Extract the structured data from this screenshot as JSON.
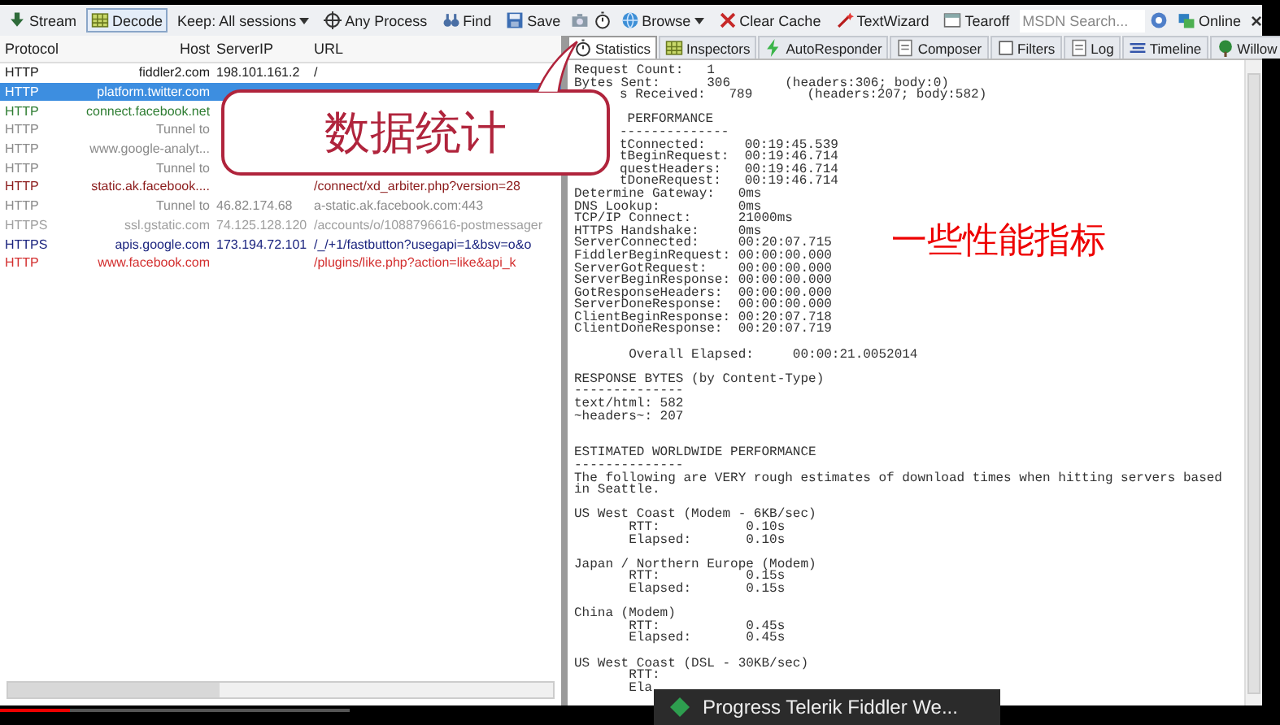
{
  "toolbar": [
    {
      "kind": "button",
      "label": "Stream"
    },
    {
      "kind": "toggle",
      "label": "Decode",
      "on": true
    },
    {
      "kind": "dropdown",
      "label": "Keep: All sessions"
    },
    {
      "kind": "button",
      "label": "Any Process"
    },
    {
      "kind": "button",
      "label": "Find"
    },
    {
      "kind": "button",
      "label": "Save"
    },
    {
      "kind": "icon"
    },
    {
      "kind": "icon"
    },
    {
      "kind": "dropdown",
      "label": "Browse"
    },
    {
      "kind": "button",
      "label": "Clear Cache"
    },
    {
      "kind": "button",
      "label": "TextWizard"
    },
    {
      "kind": "button",
      "label": "Tearoff"
    },
    {
      "kind": "search",
      "placeholder": "MSDN Search..."
    },
    {
      "kind": "icon"
    },
    {
      "kind": "button",
      "label": "Online"
    },
    {
      "kind": "close",
      "label": "×"
    }
  ],
  "sessions": {
    "columns": [
      "Protocol",
      "Host",
      "ServerIP",
      "URL"
    ],
    "rows": [
      {
        "protocol": "HTTP",
        "host": "fiddler2.com",
        "server_ip": "198.101.161.2",
        "url": "/",
        "color": "#202020",
        "selected": false
      },
      {
        "protocol": "HTTP",
        "host": "platform.twitter.com",
        "selected": true
      },
      {
        "protocol": "HTTP",
        "host": "connect.facebook.net",
        "color": "#2e7d32",
        "selected": false
      },
      {
        "protocol": "HTTP",
        "host": "Tunnel to",
        "color": "#8a8a8a",
        "selected": false
      },
      {
        "protocol": "HTTP",
        "host": "www.google-analyt...",
        "color": "#8a8a8a",
        "selected": false
      },
      {
        "protocol": "HTTP",
        "host": "Tunnel to",
        "color": "#8a8a8a",
        "selected": false
      },
      {
        "protocol": "HTTP",
        "host": "static.ak.facebook....",
        "url": "/connect/xd_arbiter.php?version=28",
        "color": "#8b1a1a",
        "selected": false
      },
      {
        "protocol": "HTTP",
        "host": "Tunnel to",
        "server_ip": "46.82.174.68",
        "url": "a-static.ak.facebook.com:443",
        "color": "#8a8a8a",
        "selected": false
      },
      {
        "protocol": "HTTPS",
        "host": "ssl.gstatic.com",
        "server_ip": "74.125.128.120",
        "url": "/accounts/o/1088796616-postmessager",
        "color": "#a0a0a0",
        "selected": false
      },
      {
        "protocol": "HTTPS",
        "host": "apis.google.com",
        "server_ip": "173.194.72.101",
        "url": "/_/+1/fastbutton?usegapi=1&bsv=o&o",
        "color": "#1a237e",
        "selected": false
      },
      {
        "protocol": "HTTP",
        "host": "www.facebook.com",
        "url": "/plugins/like.php?action=like&api_k",
        "color": "#d32f2f",
        "selected": false
      }
    ]
  },
  "tabs": [
    {
      "label": "Statistics",
      "selected": true
    },
    {
      "label": "Inspectors",
      "selected": false
    },
    {
      "label": "AutoResponder",
      "selected": false
    },
    {
      "label": "Composer",
      "selected": false
    },
    {
      "label": "Filters",
      "selected": false
    },
    {
      "label": "Log",
      "selected": false
    },
    {
      "label": "Timeline",
      "selected": false
    },
    {
      "label": "Willow",
      "selected": false
    }
  ],
  "statistics": [
    {
      "kind": "line",
      "text": "Request Count:   1"
    },
    {
      "kind": "line",
      "text": "Bytes Sent:      306       (headers:306; body:0)"
    },
    {
      "kind": "partial",
      "text": "s Received:   789       (headers:207; body:582)"
    },
    {
      "kind": "blank"
    },
    {
      "kind": "partial",
      "text": " PERFORMANCE"
    },
    {
      "kind": "partial",
      "text": "--------------"
    },
    {
      "kind": "partial",
      "text": "tConnected:     00:19:45.539"
    },
    {
      "kind": "partial",
      "text": "tBeginRequest:  00:19:46.714"
    },
    {
      "kind": "partial",
      "text": "questHeaders:   00:19:46.714"
    },
    {
      "kind": "partial",
      "text": "tDoneRequest:   00:19:46.714"
    },
    {
      "kind": "line",
      "text": "Determine Gateway:   0ms"
    },
    {
      "kind": "line",
      "text": "DNS Lookup:          0ms"
    },
    {
      "kind": "line",
      "text": "TCP/IP Connect:      21000ms"
    },
    {
      "kind": "line",
      "text": "HTTPS Handshake:     0ms"
    },
    {
      "kind": "line",
      "text": "ServerConnected:     00:20:07.715"
    },
    {
      "kind": "line",
      "text": "FiddlerBeginRequest: 00:00:00.000"
    },
    {
      "kind": "line",
      "text": "ServerGotRequest:    00:00:00.000"
    },
    {
      "kind": "line",
      "text": "ServerBeginResponse: 00:00:00.000"
    },
    {
      "kind": "line",
      "text": "GotResponseHeaders:  00:00:00.000"
    },
    {
      "kind": "line",
      "text": "ServerDoneResponse:  00:00:00.000"
    },
    {
      "kind": "line",
      "text": "ClientBeginResponse: 00:20:07.718"
    },
    {
      "kind": "line",
      "text": "ClientDoneResponse:  00:20:07.719"
    },
    {
      "kind": "blank"
    },
    {
      "kind": "line",
      "text": "       Overall Elapsed:     00:00:21.0052014"
    },
    {
      "kind": "blank"
    },
    {
      "kind": "line",
      "text": "RESPONSE BYTES (by Content-Type)"
    },
    {
      "kind": "line",
      "text": "--------------"
    },
    {
      "kind": "line",
      "text": "text/html: 582"
    },
    {
      "kind": "line",
      "text": "~headers~: 207"
    },
    {
      "kind": "blank"
    },
    {
      "kind": "blank"
    },
    {
      "kind": "line",
      "text": "ESTIMATED WORLDWIDE PERFORMANCE"
    },
    {
      "kind": "line",
      "text": "--------------"
    },
    {
      "kind": "line",
      "text": "The following are VERY rough estimates of download times when hitting servers based"
    },
    {
      "kind": "line",
      "text": "in Seattle."
    },
    {
      "kind": "blank"
    },
    {
      "kind": "line",
      "text": "US West Coast (Modem - 6KB/sec)"
    },
    {
      "kind": "line",
      "text": "       RTT:           0.10s"
    },
    {
      "kind": "line",
      "text": "       Elapsed:       0.10s"
    },
    {
      "kind": "blank"
    },
    {
      "kind": "line",
      "text": "Japan / Northern Europe (Modem)"
    },
    {
      "kind": "line",
      "text": "       RTT:           0.15s"
    },
    {
      "kind": "line",
      "text": "       Elapsed:       0.15s"
    },
    {
      "kind": "blank"
    },
    {
      "kind": "line",
      "text": "China (Modem)"
    },
    {
      "kind": "line",
      "text": "       RTT:           0.45s"
    },
    {
      "kind": "line",
      "text": "       Elapsed:       0.45s"
    },
    {
      "kind": "blank"
    },
    {
      "kind": "line",
      "text": "US West Coast (DSL - 30KB/sec)"
    },
    {
      "kind": "line",
      "text": "       RTT:"
    },
    {
      "kind": "line",
      "text": "       Ela"
    }
  ],
  "callout": "数据统计",
  "annotation": "一些性能指标",
  "video_progress": {
    "level": 0.2
  },
  "taskbar_tooltip": "Progress Telerik Fiddler We..."
}
